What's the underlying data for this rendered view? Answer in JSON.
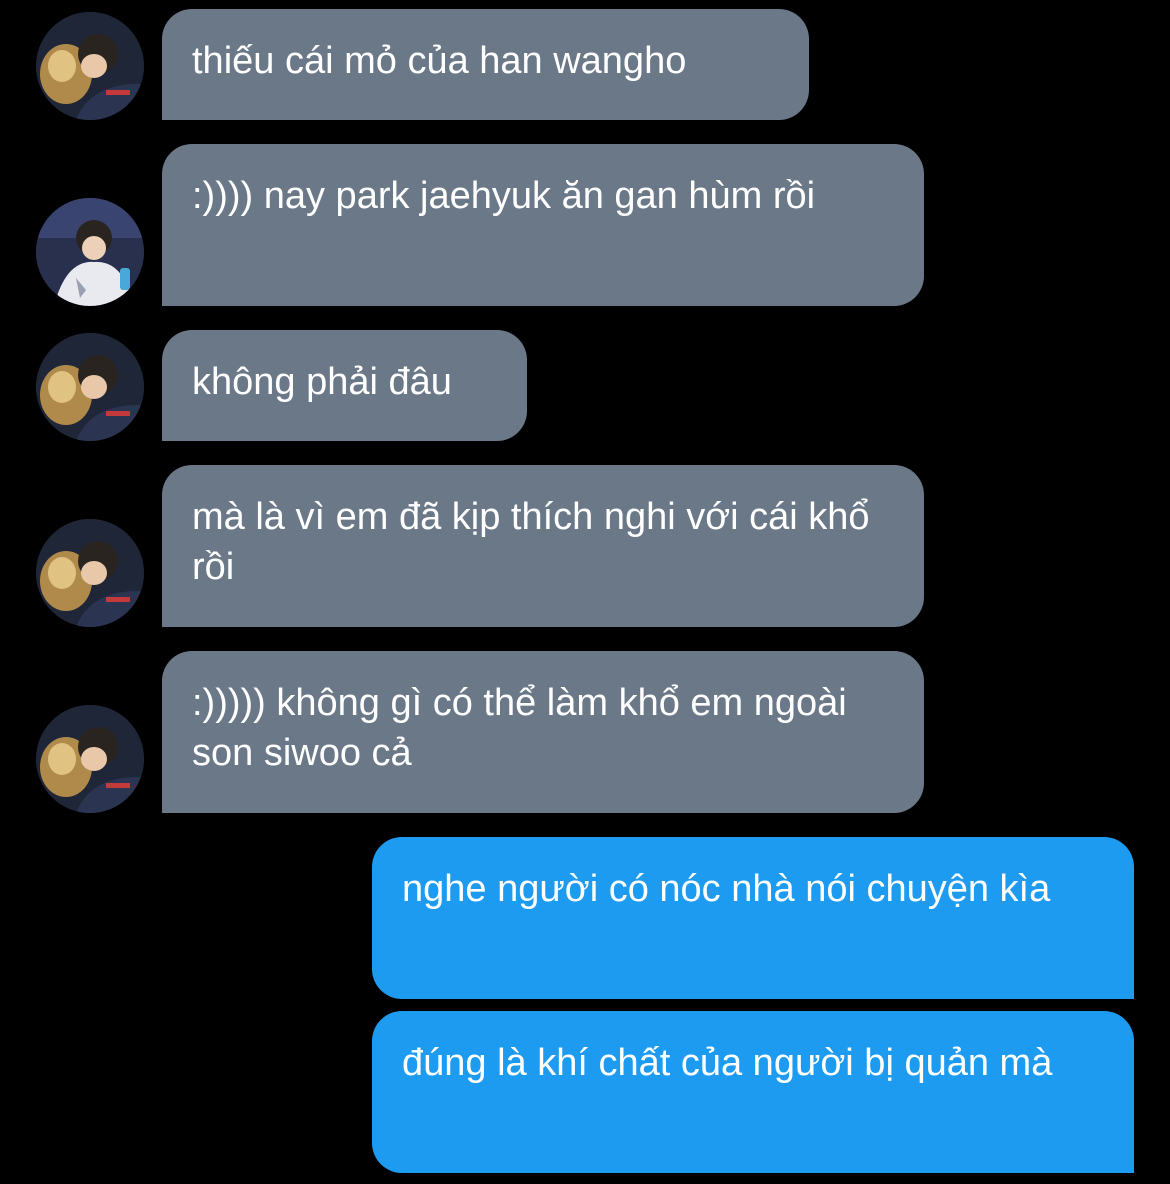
{
  "conversation": {
    "messages": [
      {
        "sender": "other",
        "avatar": "avatar-trophy-photo",
        "text": "thiếu cái mỏ của han wangho"
      },
      {
        "sender": "other",
        "avatar": "avatar-white-jacket-photo",
        "text": ":)))) nay park jaehyuk ăn gan hùm rồi"
      },
      {
        "sender": "other",
        "avatar": "avatar-trophy-photo",
        "text": "không phải đâu"
      },
      {
        "sender": "other",
        "avatar": "avatar-trophy-photo",
        "text": "mà là vì em đã kịp thích nghi với cái khổ rồi"
      },
      {
        "sender": "other",
        "avatar": "avatar-trophy-photo",
        "text": ":))))) không gì có thể làm khổ em ngoài son siwoo cả"
      },
      {
        "sender": "me",
        "text": "nghe người có nóc nhà nói chuyện kìa"
      },
      {
        "sender": "me",
        "text": "đúng là khí chất của người bị quản mà"
      }
    ]
  },
  "colors": {
    "background": "#000000",
    "incoming_bubble": "#6a7888",
    "outgoing_bubble": "#1d9bf0",
    "text": "#ffffff"
  }
}
